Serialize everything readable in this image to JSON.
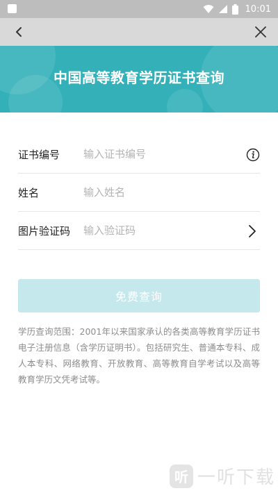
{
  "status_bar": {
    "time": "10:01"
  },
  "header": {
    "title": "中国高等教育学历证书查询"
  },
  "form": {
    "fields": [
      {
        "label": "证书编号",
        "placeholder": "输入证书编号"
      },
      {
        "label": "姓名",
        "placeholder": "输入姓名"
      },
      {
        "label": "图片验证码",
        "placeholder": "输入验证码"
      }
    ]
  },
  "actions": {
    "query_label": "免费查询"
  },
  "notice": {
    "text": "学历查询范围：2001年以来国家承认的各类高等教育学历证书电子注册信息（含学历证明书）。包括研究生、普通本专科、成人本专科、网络教育、开放教育、高等教育自学考试以及高等教育学历文凭考试等。"
  },
  "watermark": {
    "logo_char": "听",
    "text": "一听下载"
  },
  "colors": {
    "header": "#33b0b8",
    "button": "#c4e8ec",
    "nav": "#d9d9d9",
    "status": "#bdbdbd"
  }
}
